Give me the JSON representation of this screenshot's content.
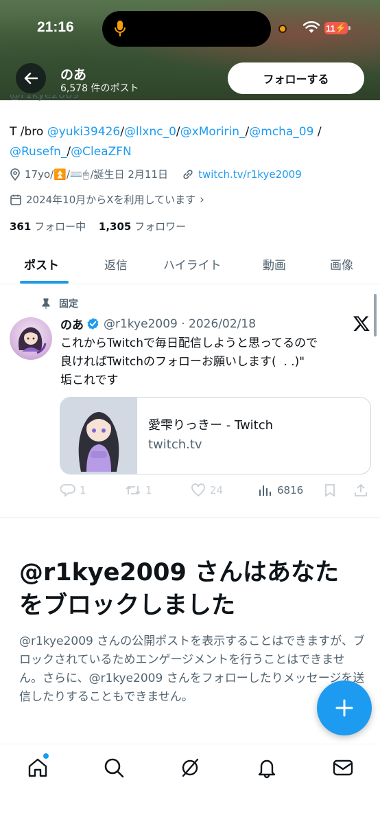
{
  "status_bar": {
    "time": "21:16",
    "battery": "11"
  },
  "header": {
    "name": "のあ",
    "post_count": "6,578 件のポスト",
    "follow_label": "フォローする"
  },
  "profile": {
    "handle_cut": "@r1kye2009",
    "bio": {
      "prefix": "T /bro ",
      "mentions": [
        "@yuki39426",
        "@llxnc_0",
        "@xMoririn_",
        "@mcha_09",
        "@Rusefn_",
        "@CleaZFN"
      ],
      "sep": "/"
    },
    "meta": {
      "location": "17yo/⏫/⌨️🖱",
      "birthday": "/誕生日 2月11日",
      "website": "twitch.tv/r1kye2009",
      "joined": "2024年10月からXを利用しています"
    },
    "following_count": "361",
    "following_label": "フォロー中",
    "followers_count": "1,305",
    "followers_label": "フォロワー"
  },
  "tabs": [
    "ポスト",
    "返信",
    "ハイライト",
    "動画",
    "画像"
  ],
  "pinned_post": {
    "pinned_label": "固定",
    "author": "のあ",
    "handle_date": "@r1kye2009 · 2026/02/18",
    "text_lines": [
      "これからTwitchで毎日配信しようと思ってるので",
      "良ければTwitchのフォローお願いします(  . .)\"",
      "垢これです"
    ],
    "card": {
      "title": "愛雫りっきー - Twitch",
      "domain": "twitch.tv"
    },
    "stats": {
      "replies": "1",
      "reposts": "1",
      "likes": "24",
      "views": "6816"
    }
  },
  "blocked": {
    "title": "@r1kye2009 さんはあなたをブロックしました",
    "description": "@r1kye2009 さんの公開ポストを表示することはできますが、ブロックされているためエンゲージメントを行うことはできません。さらに、@r1kye2009 さんをフォローしたりメッセージを送信したりすることもできません。"
  },
  "bottom_nav": [
    "home-icon",
    "search-icon",
    "grok-icon",
    "bell-icon",
    "mail-icon"
  ],
  "colors": {
    "accent": "#1d9bf0",
    "text": "#0f1419",
    "secondary": "#536471"
  }
}
